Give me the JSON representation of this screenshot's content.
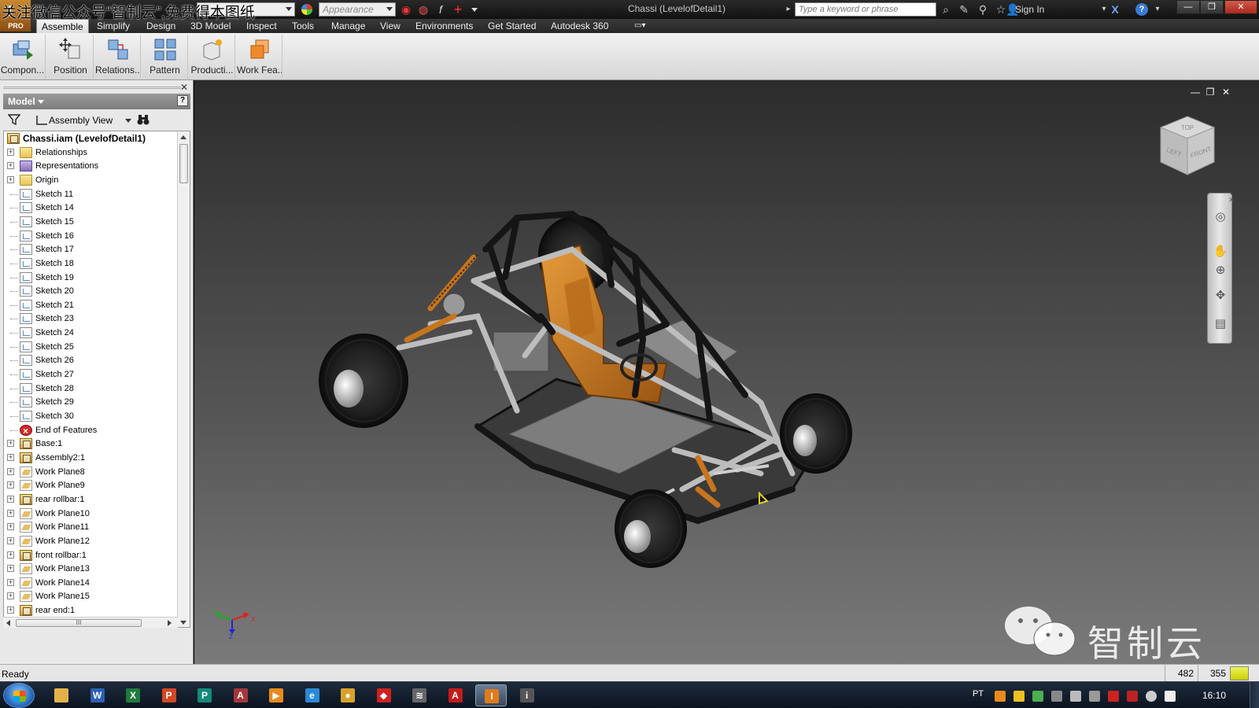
{
  "titlebar": {
    "watermark_text": "关注微信公众号“智制云”,免费得本图纸",
    "app_badge": "PRO",
    "material_value": "",
    "appearance_placeholder": "Appearance",
    "window_title": "Chassi (LevelofDetail1)",
    "search_placeholder": "Type a keyword or phrase",
    "sign_in_label": "Sign In"
  },
  "menu": {
    "tabs": [
      {
        "label": "Assemble"
      },
      {
        "label": "Simplify"
      },
      {
        "label": "Design"
      },
      {
        "label": "3D Model"
      },
      {
        "label": "Inspect"
      },
      {
        "label": "Tools"
      },
      {
        "label": "Manage"
      },
      {
        "label": "View"
      },
      {
        "label": "Environments"
      },
      {
        "label": "Get Started"
      },
      {
        "label": "Autodesk 360"
      }
    ],
    "active_tab": "Assemble"
  },
  "ribbon": {
    "buttons": [
      {
        "label": "Compon...",
        "icon": "place-component-icon"
      },
      {
        "label": "Position",
        "icon": "move-component-icon"
      },
      {
        "label": "Relations...",
        "icon": "constraint-icon"
      },
      {
        "label": "Pattern",
        "icon": "pattern-icon"
      },
      {
        "label": "Producti...",
        "icon": "productivity-icon"
      },
      {
        "label": "Work Fea...",
        "icon": "work-feature-icon"
      }
    ]
  },
  "browser": {
    "title": "Model",
    "help_label": "?",
    "view_label": "Assembly View",
    "root": "Chassi.iam (LevelofDetail1)",
    "items": [
      {
        "label": "Relationships",
        "type": "folder",
        "expandable": true
      },
      {
        "label": "Representations",
        "type": "rep",
        "expandable": true
      },
      {
        "label": "Origin",
        "type": "folder",
        "expandable": true
      },
      {
        "label": "Sketch 11",
        "type": "sketch",
        "expandable": false
      },
      {
        "label": "Sketch 14",
        "type": "sketch",
        "expandable": false
      },
      {
        "label": "Sketch 15",
        "type": "sketch",
        "expandable": false
      },
      {
        "label": "Sketch 16",
        "type": "sketch",
        "expandable": false
      },
      {
        "label": "Sketch 17",
        "type": "sketch",
        "expandable": false
      },
      {
        "label": "Sketch 18",
        "type": "sketch",
        "expandable": false
      },
      {
        "label": "Sketch 19",
        "type": "sketch",
        "expandable": false
      },
      {
        "label": "Sketch 20",
        "type": "sketch",
        "expandable": false
      },
      {
        "label": "Sketch 21",
        "type": "sketch",
        "expandable": false
      },
      {
        "label": "Sketch 23",
        "type": "sketch",
        "expandable": false
      },
      {
        "label": "Sketch 24",
        "type": "sketch",
        "expandable": false
      },
      {
        "label": "Sketch 25",
        "type": "sketch",
        "expandable": false
      },
      {
        "label": "Sketch 26",
        "type": "sketch",
        "expandable": false
      },
      {
        "label": "Sketch 27",
        "type": "sketch",
        "expandable": false
      },
      {
        "label": "Sketch 28",
        "type": "sketch",
        "expandable": false
      },
      {
        "label": "Sketch 29",
        "type": "sketch",
        "expandable": false
      },
      {
        "label": "Sketch 30",
        "type": "sketch",
        "expandable": false
      },
      {
        "label": "End of Features",
        "type": "end",
        "expandable": false
      },
      {
        "label": "Base:1",
        "type": "asm",
        "expandable": true
      },
      {
        "label": "Assembly2:1",
        "type": "asm",
        "expandable": true
      },
      {
        "label": "Work Plane8",
        "type": "plane",
        "expandable": true
      },
      {
        "label": "Work Plane9",
        "type": "plane",
        "expandable": true
      },
      {
        "label": "rear rollbar:1",
        "type": "asm",
        "expandable": true
      },
      {
        "label": "Work Plane10",
        "type": "plane",
        "expandable": true
      },
      {
        "label": "Work Plane11",
        "type": "plane",
        "expandable": true
      },
      {
        "label": "Work Plane12",
        "type": "plane",
        "expandable": true
      },
      {
        "label": "front rollbar:1",
        "type": "asm",
        "expandable": true
      },
      {
        "label": "Work Plane13",
        "type": "plane",
        "expandable": true
      },
      {
        "label": "Work Plane14",
        "type": "plane",
        "expandable": true
      },
      {
        "label": "Work Plane15",
        "type": "plane",
        "expandable": true
      },
      {
        "label": "rear end:1",
        "type": "asm",
        "expandable": true
      }
    ]
  },
  "viewport": {
    "viewcube_faces": {
      "top": "TOP",
      "left": "LEFT",
      "front": "FRONT"
    },
    "axis_labels": {
      "x": "X",
      "y": "Y",
      "z": "Z"
    },
    "watermark_text": "智制云"
  },
  "status": {
    "text": "Ready",
    "coord_x": "482",
    "coord_y": "355"
  },
  "taskbar": {
    "lang": "PT",
    "clock": "16:10",
    "apps": [
      {
        "name": "explorer",
        "glyph": "",
        "color": "#e3b34a"
      },
      {
        "name": "word",
        "glyph": "W",
        "color": "#2b5fb4"
      },
      {
        "name": "excel",
        "glyph": "X",
        "color": "#1e7b3c"
      },
      {
        "name": "powerpoint",
        "glyph": "P",
        "color": "#d24726"
      },
      {
        "name": "publisher",
        "glyph": "P",
        "color": "#138a7a"
      },
      {
        "name": "access",
        "glyph": "A",
        "color": "#a4373a"
      },
      {
        "name": "media-player",
        "glyph": "▶",
        "color": "#e88a1a"
      },
      {
        "name": "internet-explorer",
        "glyph": "e",
        "color": "#2a8ad8"
      },
      {
        "name": "chrome",
        "glyph": "●",
        "color": "#d8a22a"
      },
      {
        "name": "autodesk-app",
        "glyph": "◆",
        "color": "#c22"
      },
      {
        "name": "layers-app",
        "glyph": "≋",
        "color": "#666"
      },
      {
        "name": "acrobat",
        "glyph": "A",
        "color": "#c41b1b"
      },
      {
        "name": "inventor",
        "glyph": "I",
        "color": "#e07b1a"
      },
      {
        "name": "info-app",
        "glyph": "i",
        "color": "#555"
      }
    ]
  },
  "colors": {
    "accent_orange": "#c8741c",
    "frame_silver": "#bdbdbd",
    "tube_black": "#1a1a1a"
  }
}
